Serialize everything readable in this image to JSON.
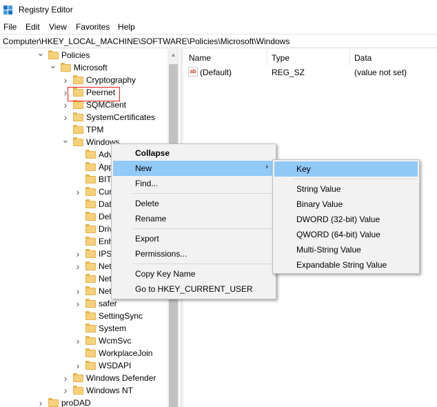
{
  "window": {
    "title": "Registry Editor",
    "app_icon": "registry-icon"
  },
  "menubar": {
    "items": [
      "File",
      "Edit",
      "View",
      "Favorites",
      "Help"
    ]
  },
  "address": {
    "path": "Computer\\HKEY_LOCAL_MACHINE\\SOFTWARE\\Policies\\Microsoft\\Windows"
  },
  "tree": {
    "nodes": [
      {
        "label": "Policies",
        "level": 0,
        "chevron": "expanded"
      },
      {
        "label": "Microsoft",
        "level": 1,
        "chevron": "expanded"
      },
      {
        "label": "Cryptography",
        "level": 2,
        "chevron": "collapsed"
      },
      {
        "label": "Peernet",
        "level": 2,
        "chevron": "collapsed"
      },
      {
        "label": "SQMClient",
        "level": 2,
        "chevron": "collapsed"
      },
      {
        "label": "SystemCertificates",
        "level": 2,
        "chevron": "collapsed"
      },
      {
        "label": "TPM",
        "level": 2,
        "chevron": "none"
      },
      {
        "label": "Windows",
        "level": 2,
        "chevron": "expanded",
        "selected": true
      },
      {
        "label": "Adve",
        "level": 3,
        "chevron": "none"
      },
      {
        "label": "Appx",
        "level": 3,
        "chevron": "none"
      },
      {
        "label": "BITS",
        "level": 3,
        "chevron": "none"
      },
      {
        "label": "Curr",
        "level": 3,
        "chevron": "collapsed"
      },
      {
        "label": "Data",
        "level": 3,
        "chevron": "none"
      },
      {
        "label": "Deliv",
        "level": 3,
        "chevron": "none"
      },
      {
        "label": "Drive",
        "level": 3,
        "chevron": "none"
      },
      {
        "label": "Enha",
        "level": 3,
        "chevron": "none"
      },
      {
        "label": "IPSe",
        "level": 3,
        "chevron": "collapsed"
      },
      {
        "label": "Netw",
        "level": 3,
        "chevron": "collapsed"
      },
      {
        "label": "Netw",
        "level": 3,
        "chevron": "none"
      },
      {
        "label": "Netw",
        "level": 3,
        "chevron": "collapsed"
      },
      {
        "label": "safer",
        "level": 3,
        "chevron": "collapsed"
      },
      {
        "label": "SettingSync",
        "level": 3,
        "chevron": "none"
      },
      {
        "label": "System",
        "level": 3,
        "chevron": "none"
      },
      {
        "label": "WcmSvc",
        "level": 3,
        "chevron": "collapsed"
      },
      {
        "label": "WorkplaceJoin",
        "level": 3,
        "chevron": "none"
      },
      {
        "label": "WSDAPI",
        "level": 3,
        "chevron": "collapsed"
      },
      {
        "label": "Windows Defender",
        "level": 2,
        "chevron": "collapsed"
      },
      {
        "label": "Windows NT",
        "level": 2,
        "chevron": "collapsed"
      },
      {
        "label": "proDAD",
        "level": 0,
        "chevron": "collapsed"
      }
    ]
  },
  "list": {
    "columns": [
      "Name",
      "Type",
      "Data"
    ],
    "rows": [
      {
        "name": "(Default)",
        "type": "REG_SZ",
        "data": "(value not set)",
        "icon": "string-value-icon"
      }
    ]
  },
  "context_menu": {
    "items": [
      {
        "label": "Collapse",
        "bold": true
      },
      {
        "label": "New",
        "highlighted": true,
        "has_submenu": true
      },
      {
        "label": "Find..."
      },
      {
        "separator": true
      },
      {
        "label": "Delete"
      },
      {
        "label": "Rename"
      },
      {
        "separator": true
      },
      {
        "label": "Export"
      },
      {
        "label": "Permissions..."
      },
      {
        "separator": true
      },
      {
        "label": "Copy Key Name"
      },
      {
        "label": "Go to HKEY_CURRENT_USER"
      }
    ]
  },
  "submenu": {
    "items": [
      {
        "label": "Key",
        "highlighted": true
      },
      {
        "separator": true
      },
      {
        "label": "String Value"
      },
      {
        "label": "Binary Value"
      },
      {
        "label": "DWORD (32-bit) Value"
      },
      {
        "label": "QWORD (64-bit) Value"
      },
      {
        "label": "Multi-String Value"
      },
      {
        "label": "Expandable String Value"
      }
    ]
  },
  "colors": {
    "highlight": "#91c9f7",
    "selection_outline": "#e81c1c",
    "folder": "#f6d17a"
  }
}
